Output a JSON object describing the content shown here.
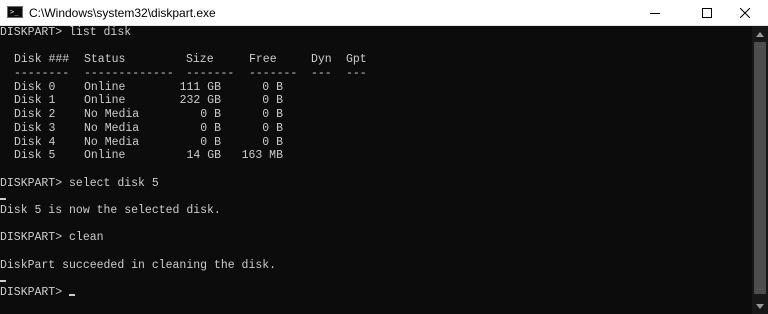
{
  "window": {
    "title": "C:\\Windows\\system32\\diskpart.exe",
    "icon_glyph": ">_"
  },
  "icons": {
    "app": "console-icon",
    "minimize": "minimize-icon",
    "maximize": "maximize-icon",
    "close": "close-icon",
    "scroll_up": "chevron-up-icon",
    "scroll_down": "chevron-down-icon"
  },
  "colors": {
    "console_background": "#0c0c0c",
    "console_text": "#cccccc",
    "titlebar_background": "#ffffff"
  },
  "console": {
    "cmd_list": "DISKPART> list disk",
    "table": {
      "headers": [
        "Disk ###",
        "Status",
        "Size",
        "Free",
        "Dyn",
        "Gpt"
      ],
      "separators": [
        "--------",
        "-------------",
        "-------",
        "-------",
        "---",
        "---"
      ],
      "rows": [
        {
          "disk": "Disk 0",
          "status": "Online",
          "size": "111 GB",
          "free": "0 B",
          "dyn": "",
          "gpt": ""
        },
        {
          "disk": "Disk 1",
          "status": "Online",
          "size": "232 GB",
          "free": "0 B",
          "dyn": "",
          "gpt": ""
        },
        {
          "disk": "Disk 2",
          "status": "No Media",
          "size": "0 B",
          "free": "0 B",
          "dyn": "",
          "gpt": ""
        },
        {
          "disk": "Disk 3",
          "status": "No Media",
          "size": "0 B",
          "free": "0 B",
          "dyn": "",
          "gpt": ""
        },
        {
          "disk": "Disk 4",
          "status": "No Media",
          "size": "0 B",
          "free": "0 B",
          "dyn": "",
          "gpt": ""
        },
        {
          "disk": "Disk 5",
          "status": "Online",
          "size": "14 GB",
          "free": "163 MB",
          "dyn": "",
          "gpt": ""
        }
      ]
    },
    "cmd_select": "DISKPART> select disk 5",
    "msg_selected": "Disk 5 is now the selected disk.",
    "cmd_clean": "DISKPART> clean",
    "msg_clean": "DiskPart succeeded in cleaning the disk.",
    "prompt": "DISKPART> "
  }
}
